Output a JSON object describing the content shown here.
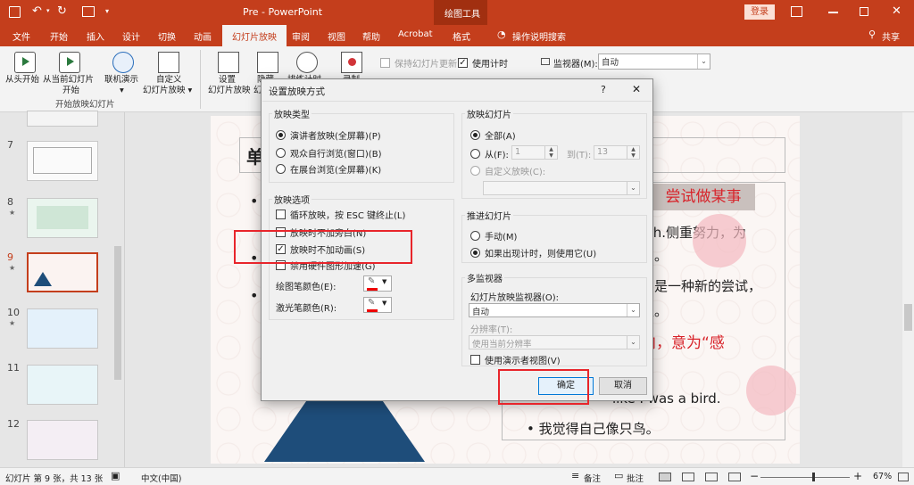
{
  "app": {
    "title": "Pre  -  PowerPoint",
    "context_tool": "绘图工具",
    "login": "登录",
    "share": "共享",
    "tell_me": "操作说明搜索"
  },
  "ribbon_tabs": [
    "文件",
    "开始",
    "插入",
    "设计",
    "切换",
    "动画",
    "幻灯片放映",
    "审阅",
    "视图",
    "帮助",
    "Acrobat",
    "格式"
  ],
  "active_tab": "幻灯片放映",
  "ribbon": {
    "from_beginning": "从头开始",
    "from_current_1": "从当前幻灯片",
    "from_current_2": "开始",
    "online_1": "联机演示",
    "online_2": "▾",
    "custom_1": "自定义",
    "custom_2": "幻灯片放映 ▾",
    "group_start": "开始放映幻灯片",
    "setup_1": "设置",
    "setup_2": "幻灯片放映",
    "hide_1": "隐藏",
    "hide_2": "幻",
    "rehearse": "排练计时",
    "record": "录制",
    "keep_updated": "保持幻灯片更新",
    "use_timings": "使用计时",
    "monitor_label": "监视器(M):",
    "monitor_value": "自动"
  },
  "thumbnails": [
    {
      "num": "7",
      "star": ""
    },
    {
      "num": "8",
      "star": "★"
    },
    {
      "num": "9",
      "star": "★"
    },
    {
      "num": "10",
      "star": "★"
    },
    {
      "num": "11",
      "star": ""
    },
    {
      "num": "12",
      "star": ""
    }
  ],
  "slide": {
    "title_char": "单",
    "heading_box": "尝试做某事",
    "line1": "sth.侧重努力，为",
    "line2": "力。",
    "line3": "只是一种新的尝试，",
    "line4": "性。",
    "line5": "向，意为“感",
    "line6": "like I was a bird.",
    "line7": "• 我觉得自己像只鸟。",
    "bullet": "•"
  },
  "dialog": {
    "title": "设置放映方式",
    "help": "?",
    "close": "✕",
    "show_type": {
      "title": "放映类型",
      "options": [
        "演讲者放映(全屏幕)(P)",
        "观众自行浏览(窗口)(B)",
        "在展台浏览(全屏幕)(K)"
      ],
      "selected": 0
    },
    "show_options": {
      "title": "放映选项",
      "items": [
        {
          "label": "循环放映，按 ESC 键终止(L)",
          "checked": false
        },
        {
          "label": "放映时不加旁白(N)",
          "checked": false
        },
        {
          "label": "放映时不加动画(S)",
          "checked": true
        },
        {
          "label": "禁用硬件图形加速(G)",
          "checked": false
        }
      ],
      "pen_color": "绘图笔颜色(E):",
      "laser_color": "激光笔颜色(R):"
    },
    "show_slides": {
      "title": "放映幻灯片",
      "all": "全部(A)",
      "from": "从(F):",
      "from_value": "1",
      "to": "到(T):",
      "to_value": "13",
      "custom": "自定义放映(C):"
    },
    "advance": {
      "title": "推进幻灯片",
      "manual": "手动(M)",
      "timings": "如果出现计时，则使用它(U)"
    },
    "multi_monitor": {
      "title": "多监视器",
      "monitor_label": "幻灯片放映监视器(O):",
      "monitor_value": "自动",
      "resolution_label": "分辨率(T):",
      "resolution_value": "使用当前分辨率",
      "presenter_view": "使用演示者视图(V)"
    },
    "ok": "确定",
    "cancel": "取消"
  },
  "status": {
    "slide_info": "幻灯片 第 9 张，共 13 张",
    "language": "中文(中国)",
    "notes": "备注",
    "comments": "批注",
    "zoom": "67%"
  },
  "colors": {
    "accent": "#c43e1c",
    "highlight": "#e8252b"
  }
}
